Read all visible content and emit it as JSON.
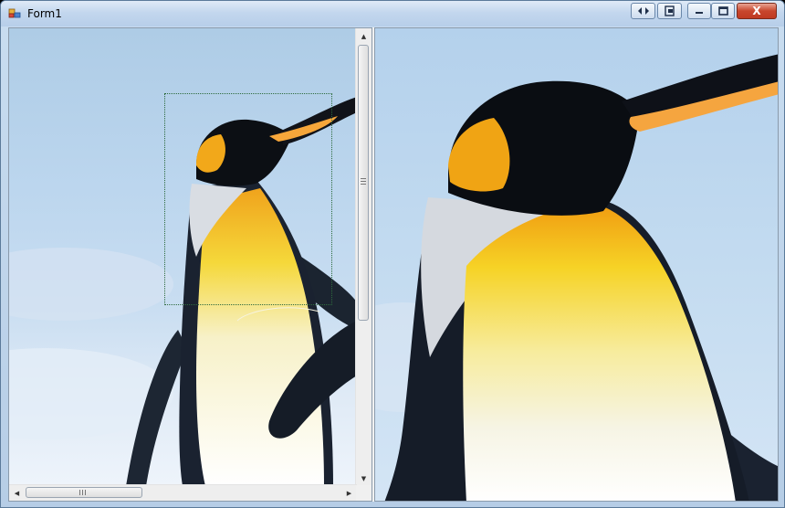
{
  "window": {
    "title": "Form1",
    "title_buttons": {
      "extra1_icon": "split-arrows-icon",
      "extra2_icon": "restore-doc-icon",
      "minimize_icon": "minimize-icon",
      "maximize_icon": "maximize-icon",
      "close_label": "X"
    }
  },
  "colors": {
    "sky": "#b9d5ee",
    "beak": "#f6a63a",
    "throat": "#f2c21a",
    "penguin_black": "#0c0f14",
    "selection_border": "#2e6b3e"
  },
  "left_panel": {
    "image_description": "penguin-full",
    "selection_rect_visible": true
  },
  "right_panel": {
    "image_description": "penguin-zoomed"
  }
}
